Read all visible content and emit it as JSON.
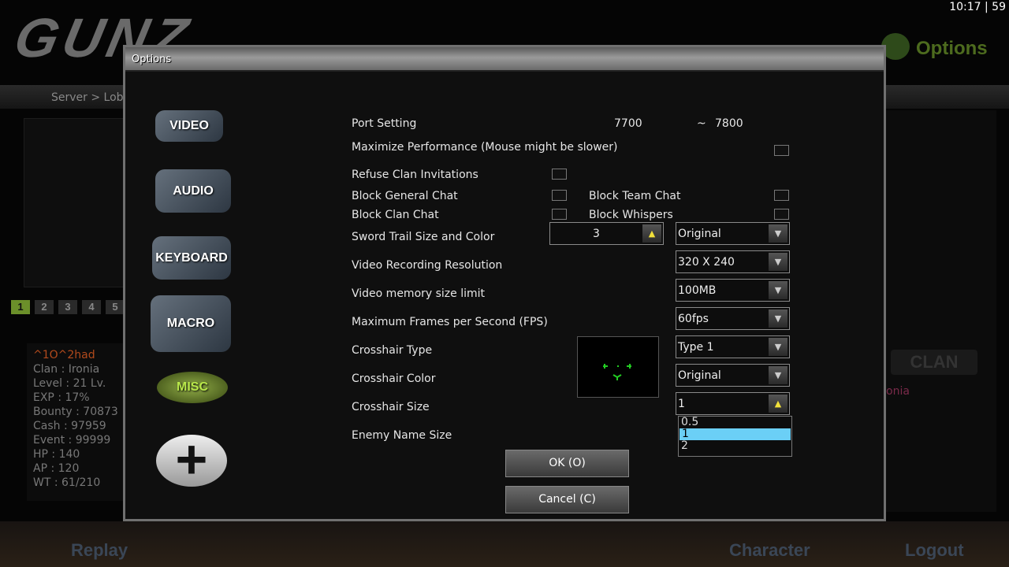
{
  "lobby": {
    "logo": "GUNZ",
    "clock": "10:17 |  59",
    "top_menu": "Options",
    "breadcrumb": "Server > Lob",
    "pages": [
      "1",
      "2",
      "3",
      "4",
      "5"
    ],
    "active_page": "1",
    "player": {
      "name": "^1O^2had",
      "stats": [
        "Clan : Ironia",
        "Level : 21 Lv.",
        "EXP : 17%",
        "Bounty : 70873",
        "Cash : 97959",
        "Event : 99999",
        "HP : 140",
        "AP : 120",
        "WT : 61/210"
      ]
    },
    "clan_tab": "CLAN",
    "clan_member": "onia",
    "bottom_nav": [
      "Replay",
      "Character",
      "Logout"
    ]
  },
  "dialog": {
    "title": "Options",
    "categories": [
      "VIDEO",
      "AUDIO",
      "KEYBOARD",
      "MACRO",
      "MISC"
    ],
    "port": {
      "label": "Port Setting",
      "from": "7700",
      "sep": "~",
      "to": "7800"
    },
    "maximize_perf": {
      "label": "Maximize Performance (Mouse might be slower)",
      "checked": false
    },
    "refuse_clan": {
      "label": "Refuse Clan Invitations",
      "checked": false
    },
    "block_general": {
      "label": "Block General Chat",
      "checked": false
    },
    "block_team": {
      "label": "Block Team Chat",
      "checked": false
    },
    "block_clan": {
      "label": "Block Clan Chat",
      "checked": false
    },
    "block_whispers": {
      "label": "Block Whispers",
      "checked": false
    },
    "sword_trail": {
      "label": "Sword Trail Size and Color",
      "size": "3",
      "color": "Original"
    },
    "video_res": {
      "label": "Video Recording Resolution",
      "value": "320 X 240"
    },
    "video_mem": {
      "label": "Video memory size limit",
      "value": "100MB"
    },
    "fps": {
      "label": "Maximum Frames per Second (FPS)",
      "value": "60fps"
    },
    "crosshair_type": {
      "label": "Crosshair Type",
      "value": "Type 1"
    },
    "crosshair_color": {
      "label": "Crosshair Color",
      "value": "Original"
    },
    "crosshair_size": {
      "label": "Crosshair Size",
      "value": "1",
      "options": [
        "0.5",
        "1",
        "2"
      ],
      "highlighted": "1"
    },
    "enemy_name": {
      "label": "Enemy Name Size"
    },
    "ok": "OK (O)",
    "cancel": "Cancel (C)",
    "colors": {
      "highlight": "#6bcff6",
      "crosshair": "#22cc22"
    }
  }
}
